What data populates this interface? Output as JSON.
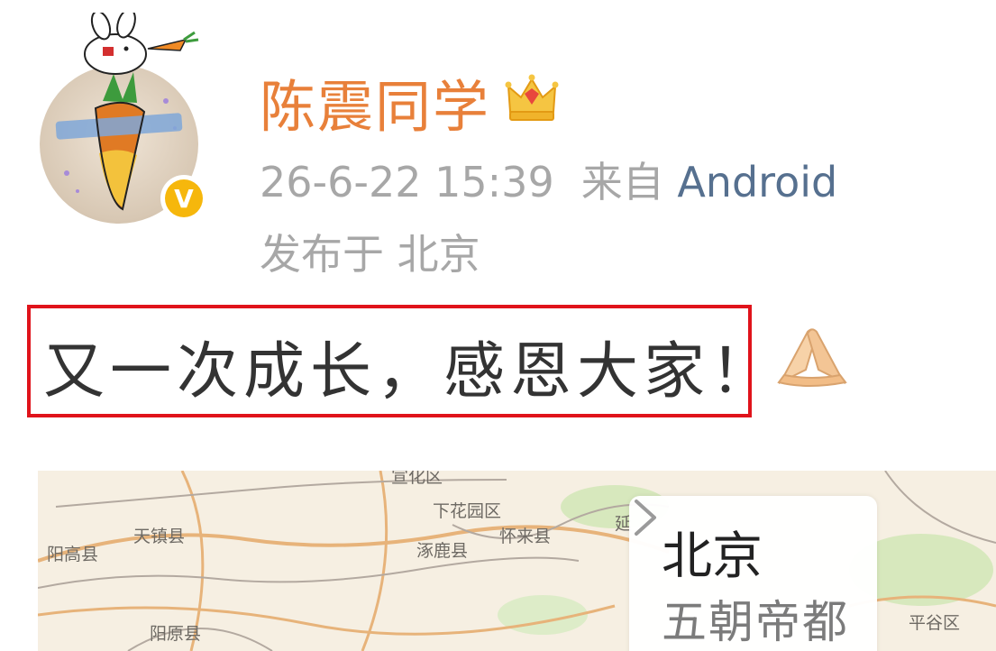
{
  "post": {
    "username": "陈震同学",
    "timestamp": "26-6-22 15:39",
    "source_prefix": "来自",
    "source": "Android",
    "location": "发布于 北京",
    "text": "又一次成长，感恩大家！",
    "emoji": "pray-hands-emoji"
  },
  "map": {
    "labels": {
      "l1": "宣化区",
      "l2": "下花园区",
      "l3": "天镇县",
      "l4": "阳高县",
      "l5": "涿鹿县",
      "l6": "怀来县",
      "l7": "阳原县",
      "l8": "平谷区",
      "l9": "延"
    },
    "card": {
      "title": "北京",
      "subtitle": "五朝帝都"
    }
  },
  "colors": {
    "username": "#e8803a",
    "meta": "#a7a7a7",
    "source": "#56708f",
    "highlight": "#e0131b",
    "verified": "#f6b70c"
  }
}
